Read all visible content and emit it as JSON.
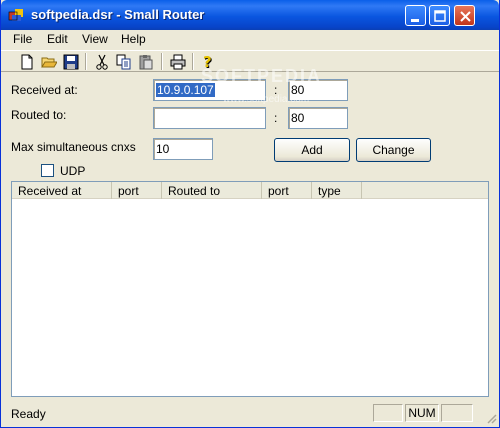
{
  "window": {
    "title": "softpedia.dsr - Small Router"
  },
  "menu": [
    "File",
    "Edit",
    "View",
    "Help"
  ],
  "toolbar": {
    "buttons": [
      "new-icon",
      "open-icon",
      "save-icon",
      "cut-icon",
      "copy-icon",
      "paste-icon",
      "print-icon",
      "help-icon"
    ]
  },
  "form": {
    "received_label": "Received at:",
    "received_address": "10.9.0.107",
    "received_port": "80",
    "routed_label": "Routed to:",
    "routed_address": "",
    "routed_port": "80",
    "max_label": "Max simultaneous cnxs",
    "max_value": "10",
    "colon": ":",
    "udp_label": "UDP",
    "udp_checked": false,
    "add_label": "Add",
    "change_label": "Change"
  },
  "table": {
    "columns": [
      "Received at",
      "port",
      "Routed to",
      "port",
      "type"
    ],
    "rows": []
  },
  "status": {
    "text": "Ready",
    "num": "NUM"
  },
  "watermark": {
    "main": "SOFTPEDIA",
    "sub": "www.softpedia.com"
  }
}
